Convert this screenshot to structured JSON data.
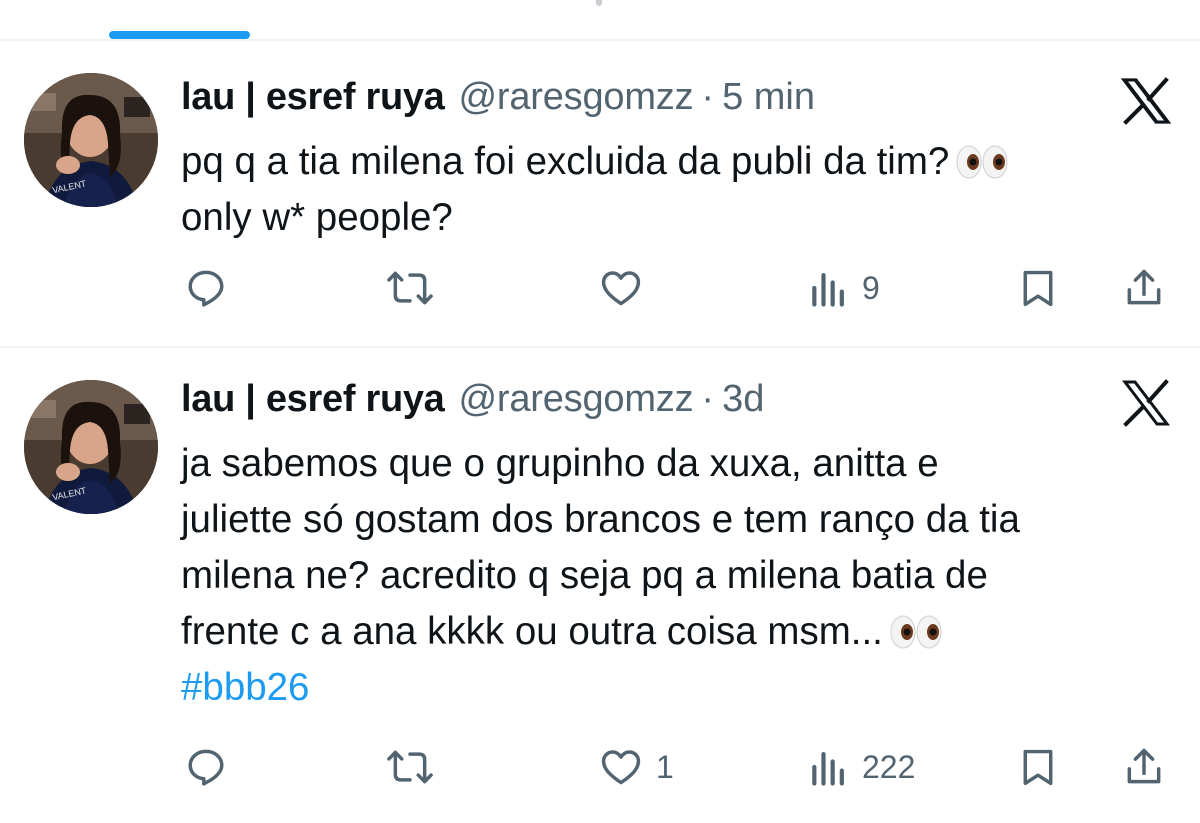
{
  "tweets": [
    {
      "display_name": "lau | esref ruya",
      "handle": "@raresgomzz",
      "separator": "·",
      "time": "5 min",
      "lines": [
        "pq q a tia milena foi excluida da publi da tim?",
        "only w* people?"
      ],
      "hashtag": "",
      "replies": "",
      "reposts": "",
      "likes": "",
      "views": "9"
    },
    {
      "display_name": "lau | esref ruya",
      "handle": "@raresgomzz",
      "separator": "·",
      "time": "3d",
      "lines": [
        "ja sabemos que o grupinho da xuxa, anitta e",
        "juliette só gostam dos brancos e tem ranço da tia",
        "milena ne? acredito q seja pq a milena batia de",
        "frente c a ana kkkk ou outra coisa msm..."
      ],
      "hashtag": "#bbb26",
      "replies": "",
      "reposts": "",
      "likes": "1",
      "views": "222"
    }
  ],
  "colors": {
    "accent": "#1d9bf0",
    "secondary_text": "#536471",
    "primary_text": "#0f1419",
    "divider": "#eff3f4"
  },
  "icons": {
    "platform_logo": "x-logo-icon",
    "emoji": "eyes-emoji-icon",
    "reply": "reply-icon",
    "repost": "repost-icon",
    "like": "like-icon",
    "views": "views-icon",
    "bookmark": "bookmark-icon",
    "share": "share-icon"
  }
}
